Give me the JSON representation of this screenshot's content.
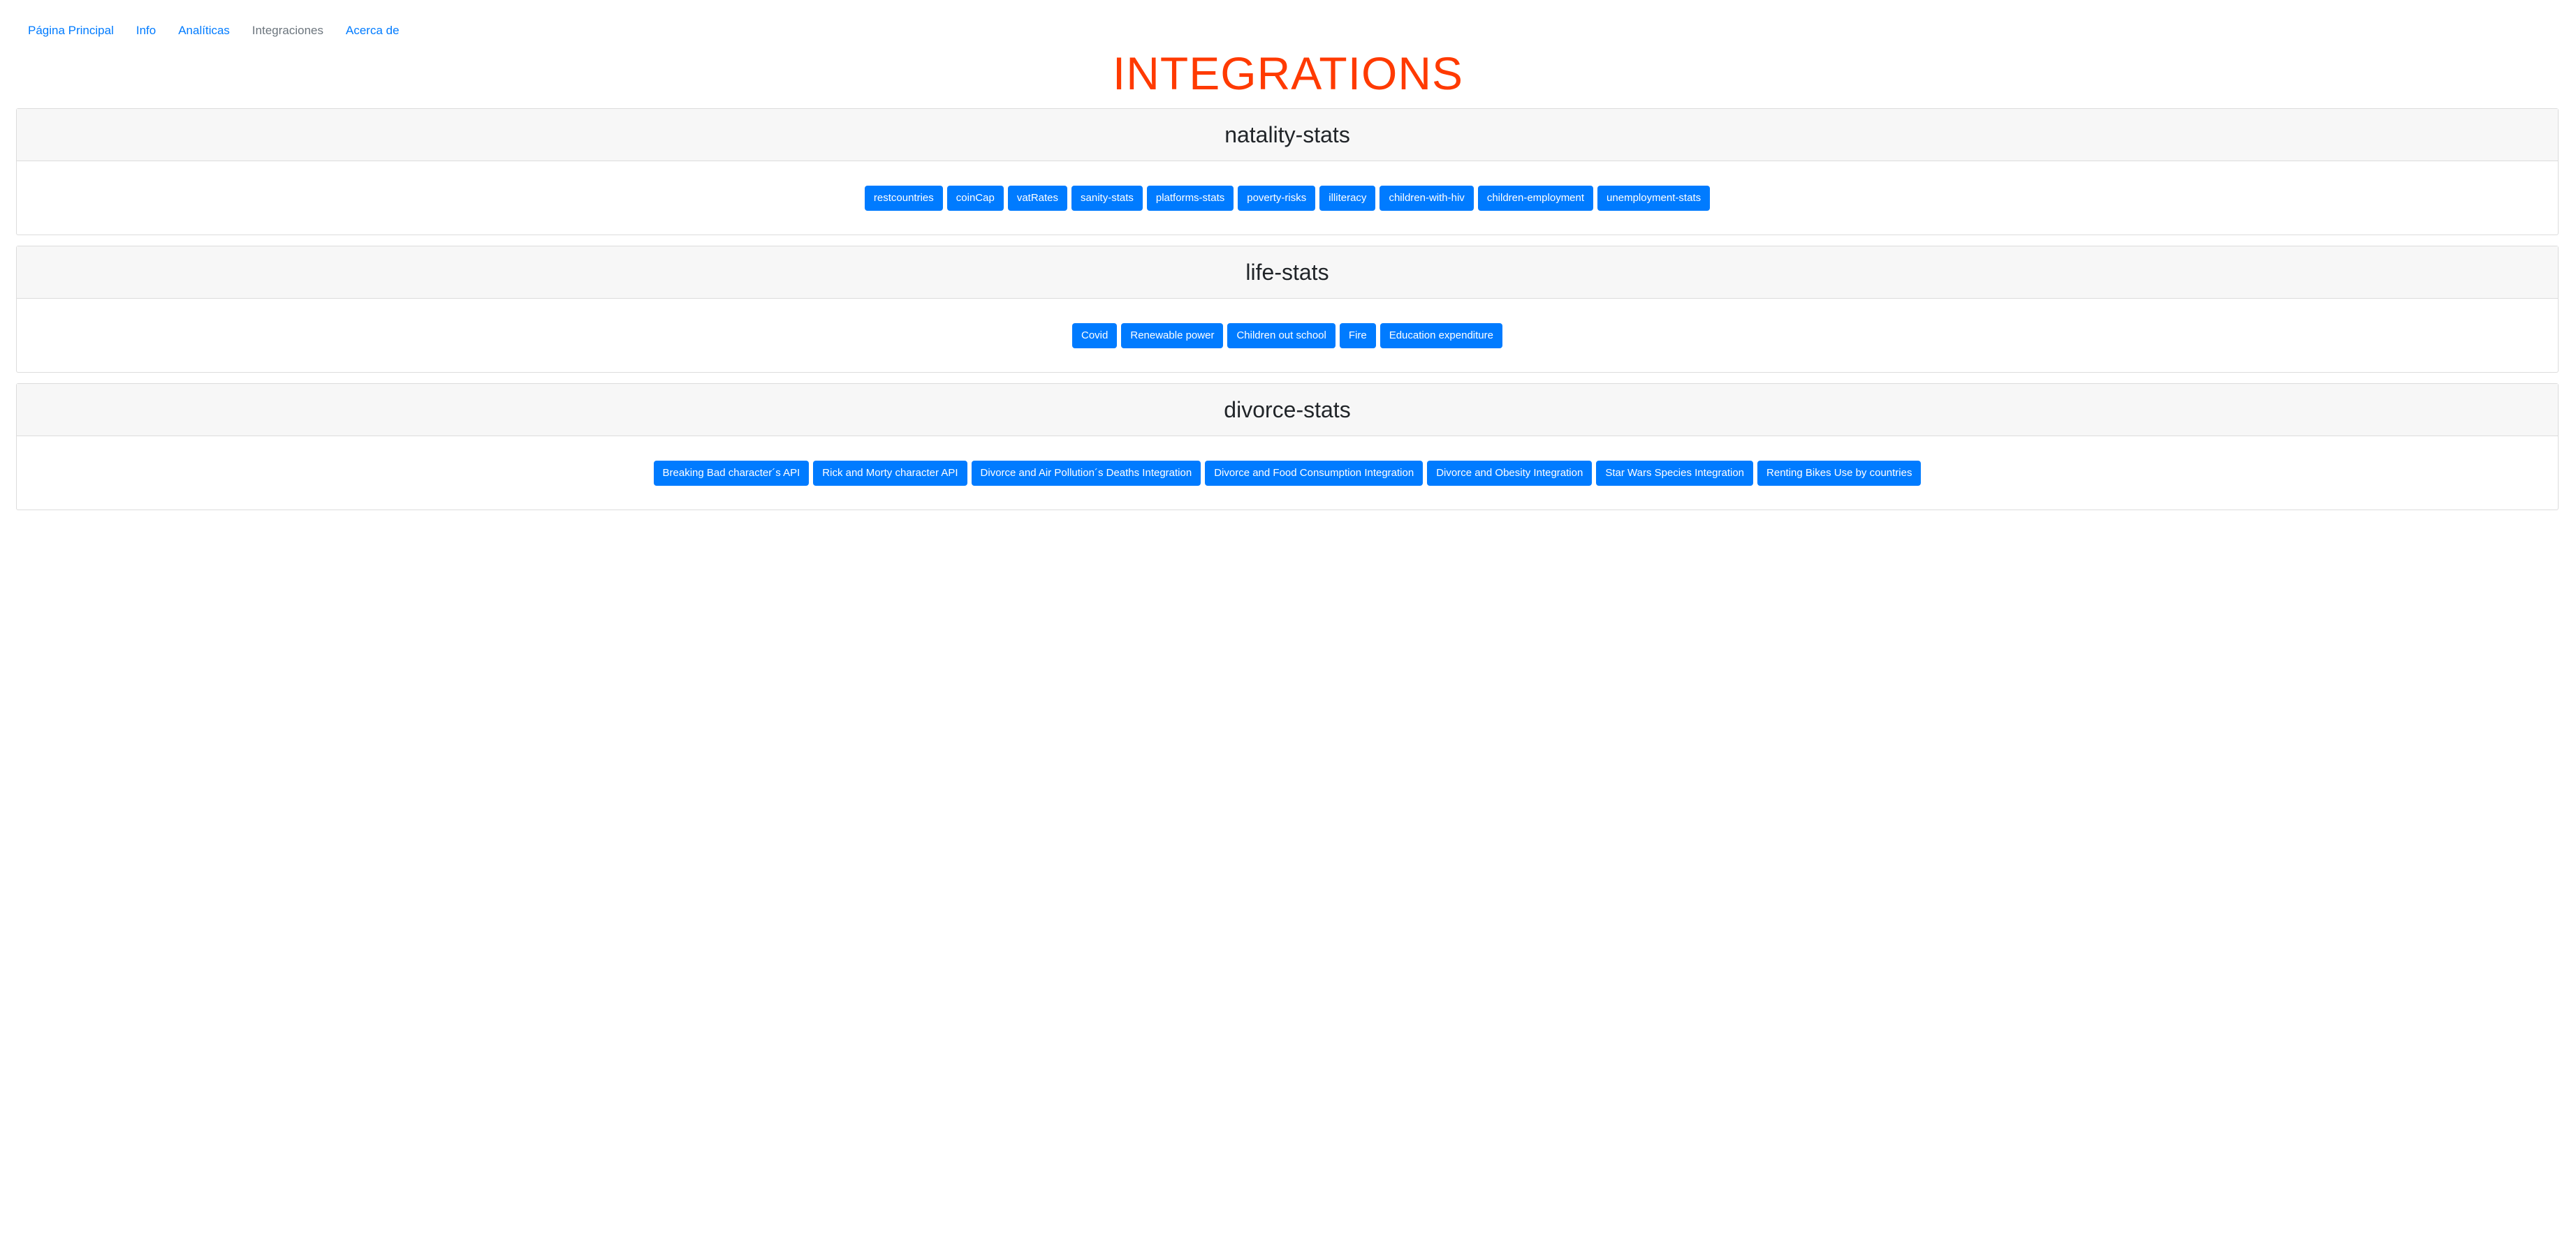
{
  "nav": {
    "items": [
      {
        "label": "Página Principal",
        "active": false
      },
      {
        "label": "Info",
        "active": false
      },
      {
        "label": "Analíticas",
        "active": false
      },
      {
        "label": "Integraciones",
        "active": true
      },
      {
        "label": "Acerca de",
        "active": false
      }
    ]
  },
  "page_title": "INTEGRATIONS",
  "sections": [
    {
      "title": "natality-stats",
      "buttons": [
        "restcountries",
        "coinCap",
        "vatRates",
        "sanity-stats",
        "platforms-stats",
        "poverty-risks",
        "illiteracy",
        "children-with-hiv",
        "children-employment",
        "unemployment-stats"
      ]
    },
    {
      "title": "life-stats",
      "buttons": [
        "Covid",
        "Renewable power",
        "Children out school",
        "Fire",
        "Education expenditure"
      ]
    },
    {
      "title": "divorce-stats",
      "buttons": [
        "Breaking Bad character´s API",
        "Rick and Morty character API",
        "Divorce and Air Pollution´s Deaths Integration",
        "Divorce and Food Consumption Integration",
        "Divorce and Obesity Integration",
        "Star Wars Species Integration",
        "Renting Bikes Use by countries"
      ]
    }
  ],
  "colors": {
    "title": "#ff3a00",
    "link": "#007bff",
    "button": "#007bff",
    "active_link": "#6c757d"
  }
}
